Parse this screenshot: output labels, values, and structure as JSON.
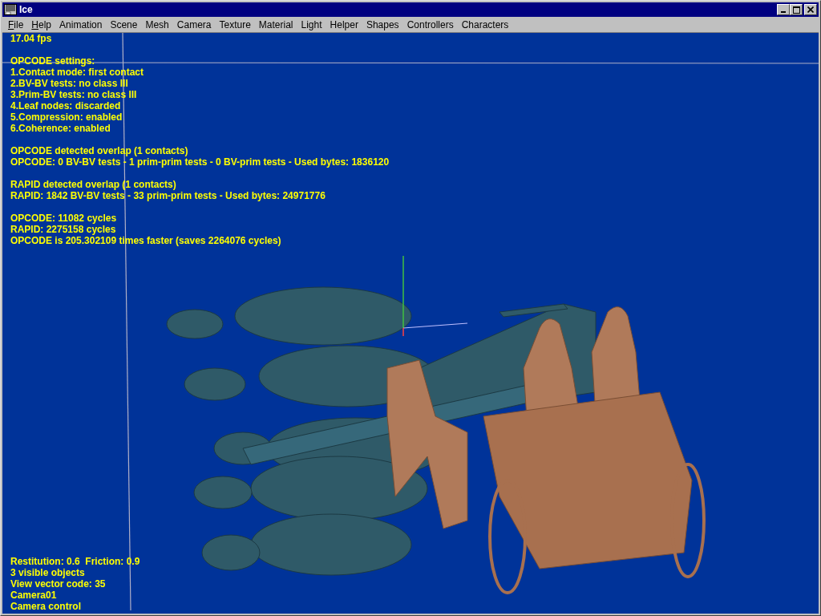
{
  "window": {
    "title": "Ice"
  },
  "menu": [
    {
      "label": "File",
      "underline_first": true
    },
    {
      "label": "Help",
      "underline_first": true
    },
    {
      "label": "Animation"
    },
    {
      "label": "Scene"
    },
    {
      "label": "Mesh"
    },
    {
      "label": "Camera"
    },
    {
      "label": "Texture"
    },
    {
      "label": "Material"
    },
    {
      "label": "Light"
    },
    {
      "label": "Helper"
    },
    {
      "label": "Shapes"
    },
    {
      "label": "Controllers"
    },
    {
      "label": "Characters"
    }
  ],
  "viewport": {
    "fps": "17.04 fps",
    "info_groups": [
      [
        "OPCODE settings:",
        "1.Contact mode: first contact",
        "2.BV-BV tests: no class III",
        "3.Prim-BV tests: no class III",
        "4.Leaf nodes: discarded",
        "5.Compression: enabled",
        "6.Coherence: enabled"
      ],
      [
        "OPCODE detected overlap (1 contacts)",
        "OPCODE: 0 BV-BV tests - 1 prim-prim tests - 0 BV-prim tests - Used bytes: 1836120"
      ],
      [
        "RAPID detected overlap (1 contacts)",
        "RAPID: 1842 BV-BV tests - 33 prim-prim tests - Used bytes: 24971776"
      ],
      [
        "OPCODE: 11082 cycles",
        "RAPID: 2275158 cycles",
        "OPCODE is 205.302109 times faster (saves 2264076 cycles)"
      ]
    ],
    "status_lines": [
      "Restitution: 0.6  Friction: 0.9",
      "3 visible objects",
      "View vector code: 35",
      "Camera01",
      "Camera control"
    ]
  }
}
